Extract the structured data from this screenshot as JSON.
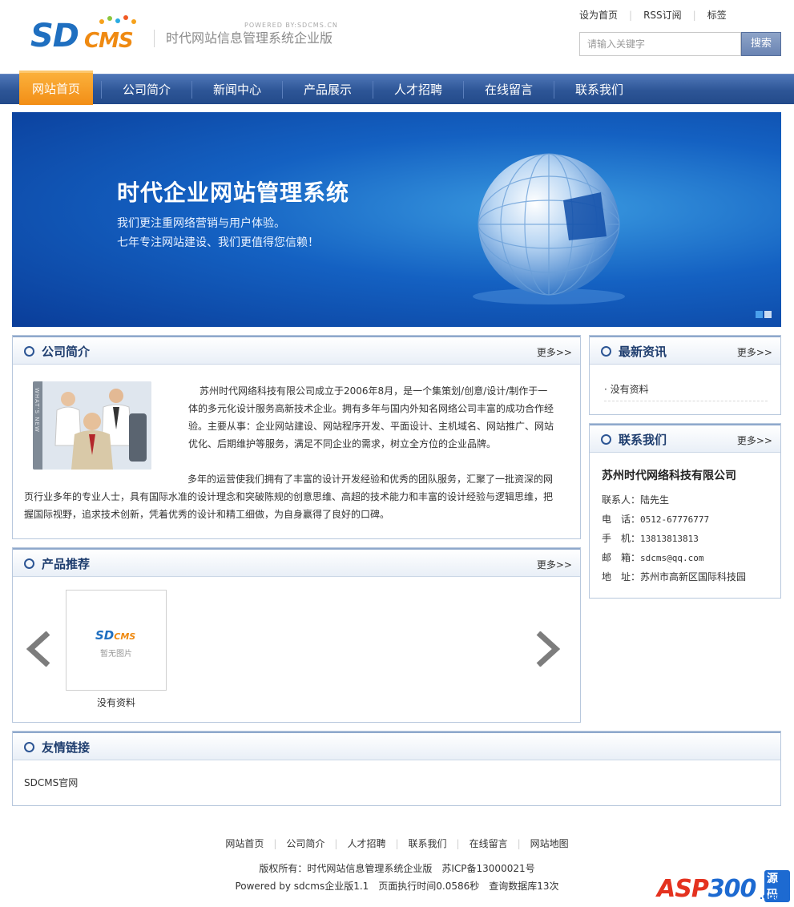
{
  "header": {
    "logo_sd": "SD",
    "logo_cms": "CMS",
    "powered": "POWERED BY:SDCMS.CN",
    "tagline": "时代网站信息管理系统企业版",
    "toplinks": [
      "设为首页",
      "RSS订阅",
      "标签"
    ],
    "search_placeholder": "请输入关键字",
    "search_button": "搜索"
  },
  "nav": [
    "网站首页",
    "公司简介",
    "新闻中心",
    "产品展示",
    "人才招聘",
    "在线留言",
    "联系我们"
  ],
  "banner": {
    "title": "时代企业网站管理系统",
    "line1": "我们更注重网络营销与用户体验。",
    "line2": "七年专注网站建设、我们更值得您信赖！",
    "photo_side_text": "WHAT'S NEW"
  },
  "about": {
    "title": "公司简介",
    "more": "更多>>",
    "p1": "苏州时代网络科技有限公司成立于2006年8月，是一个集策划/创意/设计/制作于一体的多元化设计服务高新技术企业。拥有多年与国内外知名网络公司丰富的成功合作经验。主要从事：企业网站建设、网站程序开发、平面设计、主机域名、网站推广、网站优化、后期维护等服务，满足不同企业的需求，树立全方位的企业品牌。",
    "p2": "多年的运营使我们拥有了丰富的设计开发经验和优秀的团队服务，汇聚了一批资深的网页行业多年的专业人士，具有国际水准的设计理念和突破陈规的创意思维、高超的技术能力和丰富的设计经验与逻辑思维，把握国际视野，追求技术创新，凭着优秀的设计和精工细做，为自身赢得了良好的口碑。"
  },
  "products": {
    "title": "产品推荐",
    "more": "更多>>",
    "thumb_sd": "SD",
    "thumb_cms": "CMS",
    "thumb_text": "暂无图片",
    "caption": "没有资料"
  },
  "news": {
    "title": "最新资讯",
    "more": "更多>>",
    "item": "· 没有资料"
  },
  "contact": {
    "title": "联系我们",
    "more": "更多>>",
    "company": "苏州时代网络科技有限公司",
    "rows": [
      {
        "label": "联系人：",
        "value": "陆先生"
      },
      {
        "label": "电　话：",
        "value": "0512-67776777"
      },
      {
        "label": "手　机：",
        "value": "13813813813"
      },
      {
        "label": "邮　箱：",
        "value": "sdcms@qq.com"
      },
      {
        "label": "地　址：",
        "value": "苏州市高新区国际科技园"
      }
    ]
  },
  "links": {
    "title": "友情链接",
    "item": "SDCMS官网"
  },
  "footer": {
    "links": [
      "网站首页",
      "公司简介",
      "人才招聘",
      "联系我们",
      "在线留言",
      "网站地图"
    ],
    "copyright": "版权所有：时代网站信息管理系统企业版　苏ICP备13000021号",
    "powered": "Powered by sdcms企业版1.1　页面执行时间0.0586秒　查询数据库13次"
  },
  "watermark": {
    "asp": "ASP",
    "num": "300",
    "ym": "源码",
    "com": ".com"
  },
  "colors": {
    "nav_blue": "#2d5596",
    "nav_active": "#f28e16",
    "heading": "#1e3d6e",
    "brand_blue": "#1f6fc0",
    "brand_orange": "#ef8a12"
  }
}
